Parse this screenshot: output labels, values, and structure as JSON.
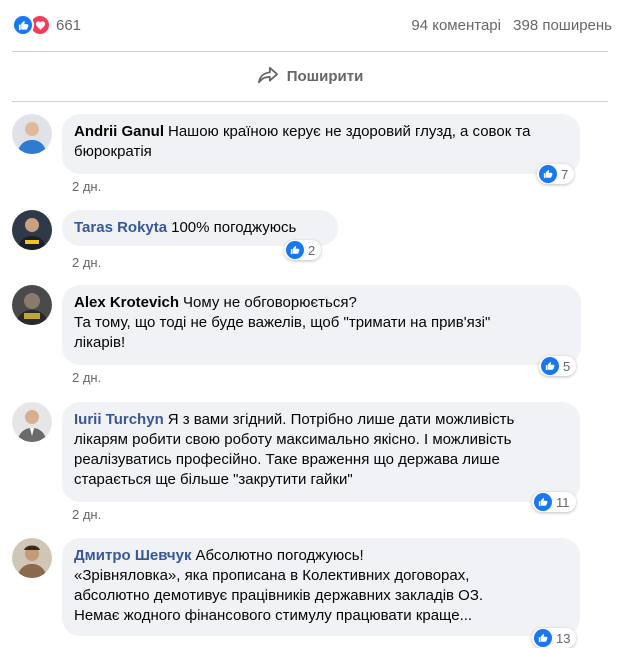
{
  "stats": {
    "reaction_count": "661",
    "comments": "94 коментарі",
    "shares": "398 поширень"
  },
  "share": {
    "label": "Поширити"
  },
  "comments": [
    {
      "author": "Andrii Ganul",
      "text_lines": [
        "Нашою країною керує не здоровий глузд, а совок та",
        "бюрократія"
      ],
      "time": "2 дн.",
      "likes": "7"
    },
    {
      "author": "Taras Rokyta",
      "text_lines": [
        "100% погоджуюсь"
      ],
      "time": "2 дн.",
      "likes": "2"
    },
    {
      "author": "Alex Krotevich",
      "text_lines": [
        "Чому не обговорюється?",
        "Та тому, що тоді не буде важелів, щоб \"тримати на прив'язі\"",
        "лікарів!"
      ],
      "time": "2 дн.",
      "likes": "5"
    },
    {
      "author": "Iurii Turchyn",
      "text_lines": [
        "Я з вами згідний. Потрібно лише дати можливість",
        "лікарям робити свою роботу максимально якісно. І можливість",
        "реалізуватись професійно. Таке враження що держава лише",
        "старається ще більше \"закрутити гайки\""
      ],
      "time": "2 дн.",
      "likes": "11"
    },
    {
      "author": "Дмитро Шевчук",
      "text_lines": [
        "Абсолютно погоджуюсь!",
        "«Зрівняловка», яка прописана в Колективних договорах,",
        "абсолютно демотивує працівників державних закладів ОЗ.",
        "Немає жодного фінансового стимулу працювати краще..."
      ],
      "time": "",
      "likes": "13"
    }
  ],
  "colors": {
    "like_blue": "#1877f2",
    "love_red": "#f33e58",
    "bubble_bg": "#f0f2f5",
    "author_link": "#385898"
  }
}
